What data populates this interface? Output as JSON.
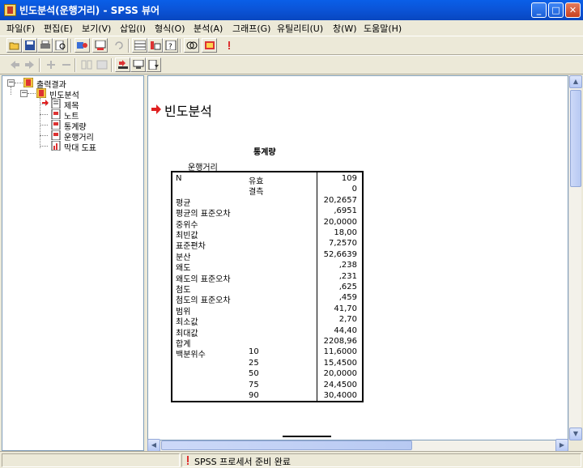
{
  "window": {
    "title": "빈도분석(운행거리) - SPSS 뷰어",
    "minimize_glyph": "_",
    "maximize_glyph": "□",
    "close_glyph": "✕"
  },
  "menu": [
    "파일(F)",
    "편집(E)",
    "보기(V)",
    "삽입(I)",
    "형식(O)",
    "분석(A)",
    "그래프(G)",
    "유틸리티(U)",
    "창(W)",
    "도움말(H)"
  ],
  "toolbar1_icons": [
    "open-icon",
    "save-icon",
    "print-icon",
    "print-preview-icon",
    "export-icon",
    "recall-dialog-icon",
    "undo-icon",
    "goto-case-icon",
    "variables-icon",
    "goto-data-icon",
    "insert-cases-icon",
    "pivot-icon",
    "designate-window-icon",
    "alert-icon"
  ],
  "toolbar2_icons": [
    "back-icon",
    "forward-icon",
    "expand-icon",
    "collapse-icon",
    "show-icon",
    "hide-icon",
    "insert-heading-icon",
    "insert-title-icon",
    "insert-text-icon"
  ],
  "outline": {
    "root": "출력결과",
    "node": "빈도분석",
    "children": [
      "제목",
      "노트",
      "통계량",
      "운행거리",
      "막대 도표"
    ]
  },
  "output": {
    "heading": "빈도분석",
    "table_title": "통계량",
    "variable": "운행거리",
    "rows": [
      {
        "label": "N",
        "sub": "유효",
        "value": "109"
      },
      {
        "label": "",
        "sub": "결측",
        "value": "0"
      },
      {
        "label": "평균",
        "sub": "",
        "value": "20,2657"
      },
      {
        "label": "평균의 표준오차",
        "sub": "",
        "value": ",6951"
      },
      {
        "label": "중위수",
        "sub": "",
        "value": "20,0000"
      },
      {
        "label": "최빈값",
        "sub": "",
        "value": "18,00"
      },
      {
        "label": "표준편차",
        "sub": "",
        "value": "7,2570"
      },
      {
        "label": "분산",
        "sub": "",
        "value": "52,6639"
      },
      {
        "label": "왜도",
        "sub": "",
        "value": ",238"
      },
      {
        "label": "왜도의 표준오차",
        "sub": "",
        "value": ",231"
      },
      {
        "label": "첨도",
        "sub": "",
        "value": ",625"
      },
      {
        "label": "첨도의 표준오차",
        "sub": "",
        "value": ",459"
      },
      {
        "label": "범위",
        "sub": "",
        "value": "41,70"
      },
      {
        "label": "최소값",
        "sub": "",
        "value": "2,70"
      },
      {
        "label": "최대값",
        "sub": "",
        "value": "44,40"
      },
      {
        "label": "합계",
        "sub": "",
        "value": "2208,96"
      },
      {
        "label": "백분위수",
        "sub": "10",
        "value": "11,6000"
      },
      {
        "label": "",
        "sub": "25",
        "value": "15,4500"
      },
      {
        "label": "",
        "sub": "50",
        "value": "20,0000"
      },
      {
        "label": "",
        "sub": "75",
        "value": "24,4500"
      },
      {
        "label": "",
        "sub": "90",
        "value": "30,4000"
      }
    ]
  },
  "status": {
    "text": "SPSS  프로세서  준비 완료"
  },
  "colors": {
    "title_bar": "#0a5fe8",
    "arrow": "#e02020"
  }
}
